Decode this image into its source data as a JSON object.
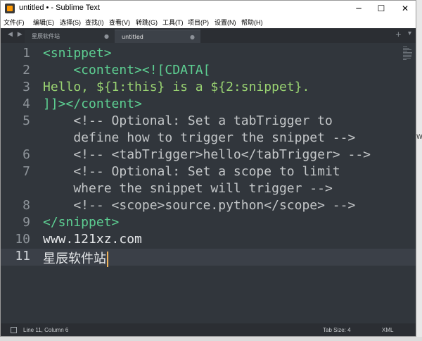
{
  "window": {
    "title": "untitled • - Sublime Text",
    "controls": {
      "minimize": "─",
      "maximize": "☐",
      "close": "✕"
    }
  },
  "menubar": [
    "文件(F)",
    "编辑(E)",
    "选择(S)",
    "查找(I)",
    "查看(V)",
    "转跳(G)",
    "工具(T)",
    "项目(P)",
    "设置(N)",
    "帮助(H)"
  ],
  "tabs": {
    "nav": "◀ ▶",
    "items": [
      {
        "label": "星辰软件站",
        "close": "●",
        "active": false
      },
      {
        "label": "untitled",
        "close": "●",
        "active": true
      }
    ],
    "add": "+",
    "more": "▾"
  },
  "editor": {
    "lines": [
      {
        "num": "1",
        "text": "<snippet>"
      },
      {
        "num": "2",
        "text": "    <content><![CDATA["
      },
      {
        "num": "3",
        "text": "Hello, ${1:this} is a ${2:snippet}."
      },
      {
        "num": "4",
        "text": "]]></content>"
      },
      {
        "num": "5",
        "text": "    <!-- Optional: Set a tabTrigger to"
      },
      {
        "num": "",
        "text": "    define how to trigger the snippet -->"
      },
      {
        "num": "6",
        "text": "    <!-- <tabTrigger>hello</tabTrigger> -->"
      },
      {
        "num": "7",
        "text": "    <!-- Optional: Set a scope to limit"
      },
      {
        "num": "",
        "text": "    where the snippet will trigger -->"
      },
      {
        "num": "8",
        "text": "    <!-- <scope>source.python</scope> -->"
      },
      {
        "num": "9",
        "text": "</snippet>"
      },
      {
        "num": "10",
        "text": "www.121xz.com"
      },
      {
        "num": "11",
        "text": "星辰软件站"
      }
    ],
    "current_line": "11"
  },
  "status": {
    "position": "Line 11, Column 6",
    "tab_size": "Tab Size: 4",
    "syntax": "XML"
  },
  "edge": {
    "fragment": "W"
  }
}
